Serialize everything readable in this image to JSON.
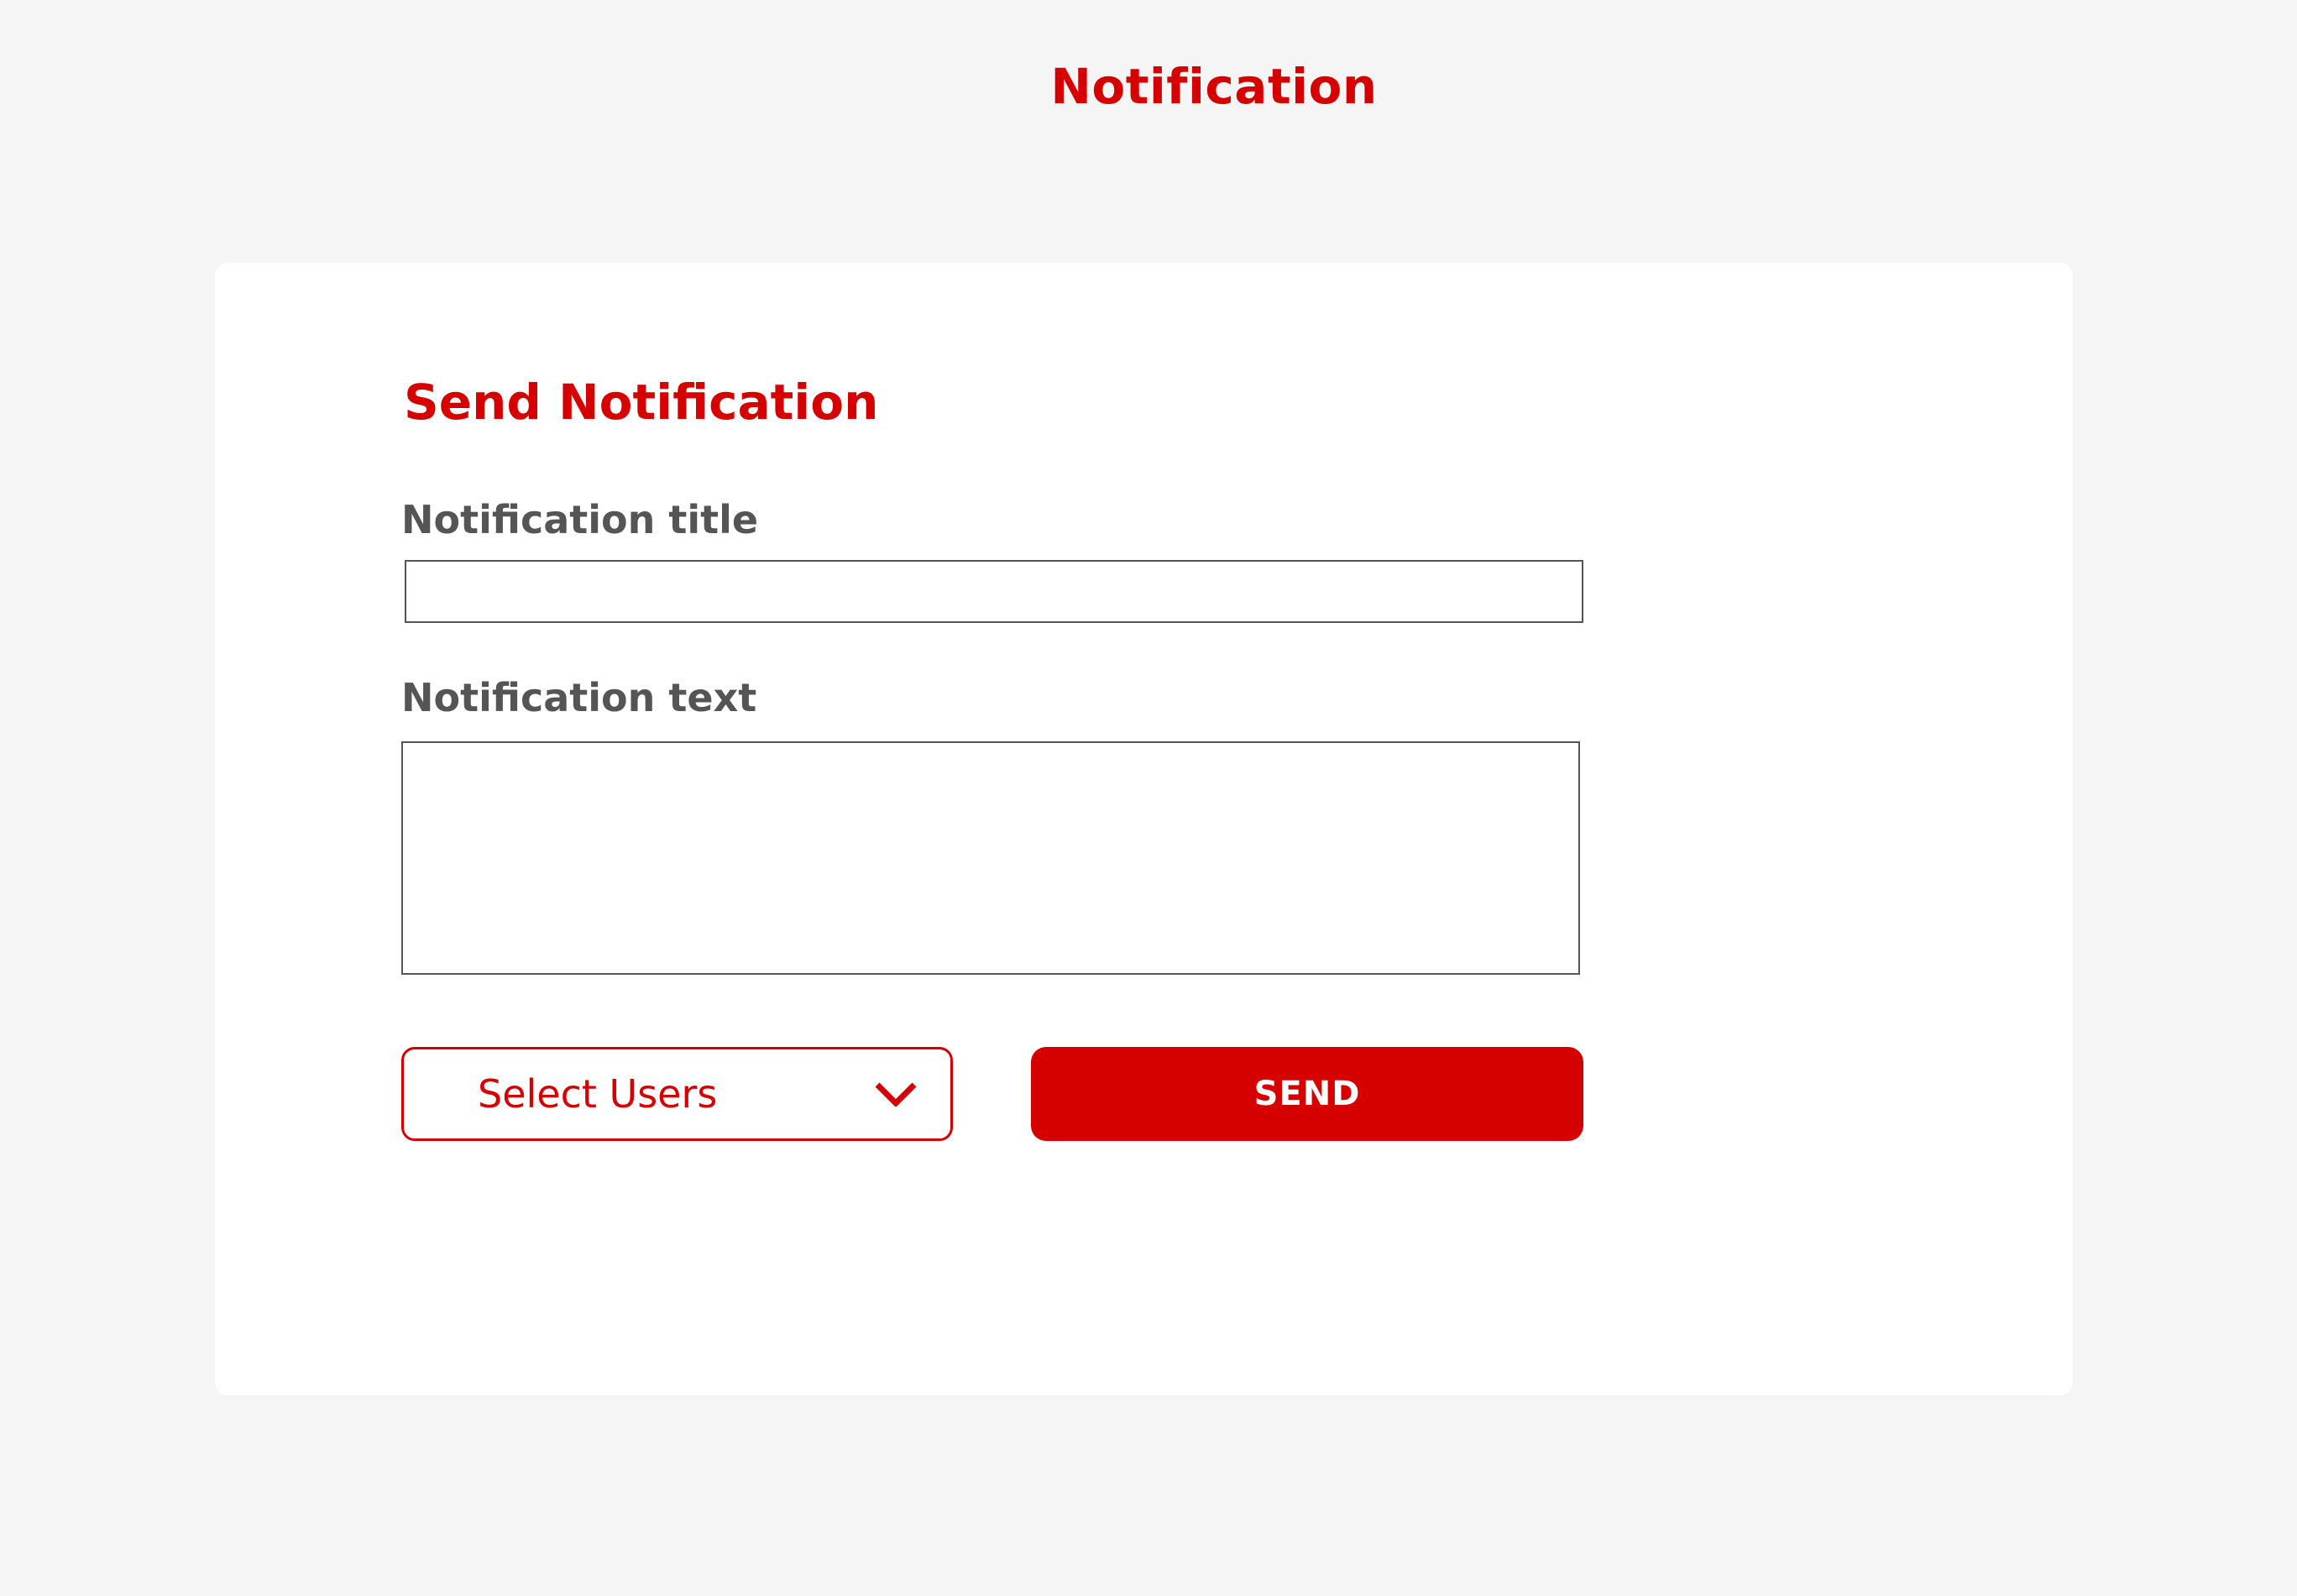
{
  "header": {
    "title": "Notification"
  },
  "form": {
    "heading": "Send Notification",
    "title_field": {
      "label": "Notification title",
      "value": "",
      "placeholder": ""
    },
    "text_field": {
      "label": "Notification text",
      "value": "",
      "placeholder": ""
    },
    "user_select": {
      "label": "Select Users",
      "icon": "chevron-down-icon"
    },
    "send_button": {
      "label": "SEND"
    }
  },
  "colors": {
    "accent": "#d50000",
    "background": "#f5f5f5",
    "card": "#ffffff",
    "label_text": "#555555",
    "border": "#555555"
  }
}
